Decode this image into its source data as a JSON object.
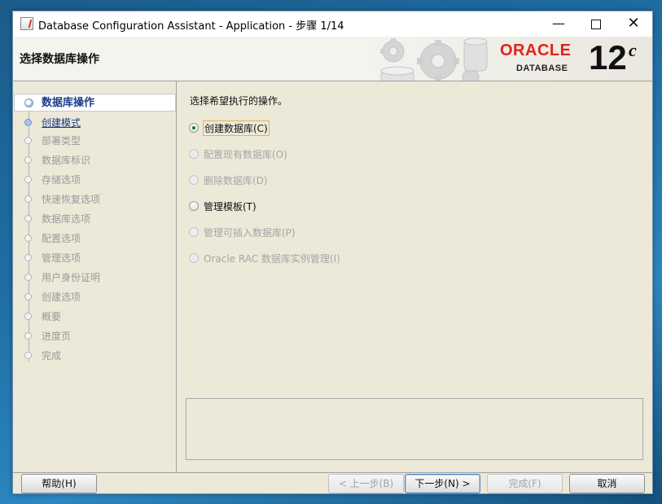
{
  "window": {
    "title": "Database Configuration Assistant - Application - 步骤 1/14",
    "minimize_glyph": "—",
    "close_glyph": "✕"
  },
  "header": {
    "step_title": "选择数据库操作",
    "logo_brand": "ORACLE",
    "logo_product": "DATABASE",
    "version_number": "12",
    "version_suffix": "c"
  },
  "steps": [
    {
      "label": "数据库操作",
      "state": "current"
    },
    {
      "label": "创建模式",
      "state": "active"
    },
    {
      "label": "部署类型",
      "state": "disabled"
    },
    {
      "label": "数据库标识",
      "state": "disabled"
    },
    {
      "label": "存储选项",
      "state": "disabled"
    },
    {
      "label": "快速恢复选项",
      "state": "disabled"
    },
    {
      "label": "数据库选项",
      "state": "disabled"
    },
    {
      "label": "配置选项",
      "state": "disabled"
    },
    {
      "label": "管理选项",
      "state": "disabled"
    },
    {
      "label": "用户身份证明",
      "state": "disabled"
    },
    {
      "label": "创建选项",
      "state": "disabled"
    },
    {
      "label": "概要",
      "state": "disabled"
    },
    {
      "label": "进度页",
      "state": "disabled"
    },
    {
      "label": "完成",
      "state": "disabled"
    }
  ],
  "main": {
    "prompt": "选择希望执行的操作。",
    "options": [
      {
        "label": "创建数据库(C)",
        "checked": true,
        "enabled": true
      },
      {
        "label": "配置现有数据库(O)",
        "checked": false,
        "enabled": false
      },
      {
        "label": "删除数据库(D)",
        "checked": false,
        "enabled": false
      },
      {
        "label": "管理模板(T)",
        "checked": false,
        "enabled": true
      },
      {
        "label": "管理可插入数据库(P)",
        "checked": false,
        "enabled": false
      },
      {
        "label": "Oracle RAC 数据库实例管理(I)",
        "checked": false,
        "enabled": false
      }
    ]
  },
  "footer": {
    "help": "帮助(H)",
    "back": "< 上一步(B)",
    "next": "下一步(N) >",
    "finish": "完成(F)",
    "cancel": "取消"
  },
  "colors": {
    "oracle_red": "#e2231a",
    "current_step_text": "#1a3a8a",
    "focus_border": "#e8b04a"
  }
}
